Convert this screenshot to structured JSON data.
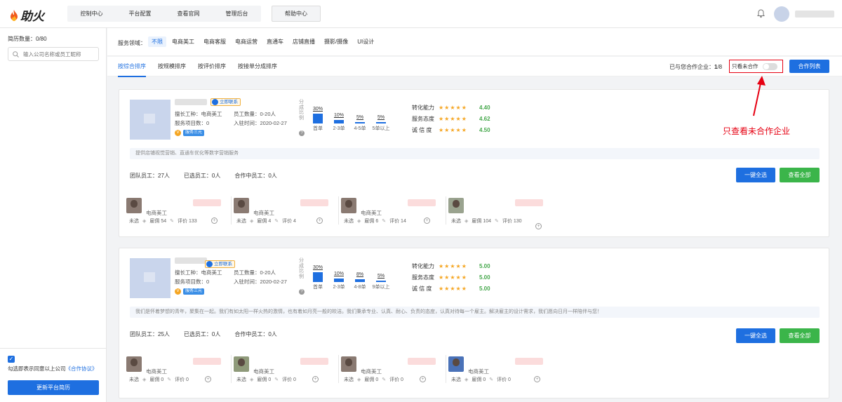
{
  "brand": {
    "name": "助火",
    "accent": "#1e6fe0",
    "logo_icon": "flame-icon"
  },
  "topnav": {
    "items": [
      "控制中心",
      "平台配置",
      "查看官网",
      "管理后台"
    ],
    "help": "帮助中心"
  },
  "sidebar": {
    "resume_count": "简历数量：0/80",
    "search_placeholder": "输入公司名称或员工昵称",
    "agree_text": "勾选即表示同意以上公司",
    "agree_link": "《合作协议》",
    "update_button": "更新平台简历"
  },
  "filter": {
    "label": "服务领域：",
    "options": [
      "不限",
      "电商美工",
      "电商客服",
      "电商运营",
      "直通车",
      "店铺直播",
      "摄影/摄像",
      "UI设计"
    ]
  },
  "sort": {
    "tabs": [
      "按综合排序",
      "按规模排序",
      "按评价排序",
      "按接单分成排序"
    ],
    "coop_prefix": "已与您合作企业：",
    "coop_value": "1",
    "coop_total": "/8",
    "toggle_label": "只看未合作",
    "coop_list_button": "合作列表"
  },
  "annotation": "只查看未合作企业",
  "cards": [
    {
      "contact": "立即联系",
      "info_left": [
        "擅长工种：电商美工",
        "服务项目数：0"
      ],
      "info_right": [
        "员工数量：0-20人",
        "入驻时间：2020-02-27"
      ],
      "service_tag": "服务三元",
      "dist_label": "分成比例",
      "bars": [
        {
          "pct": "30%",
          "value": 30,
          "cat": "首单"
        },
        {
          "pct": "10%",
          "value": 10,
          "cat": "2-3单"
        },
        {
          "pct": "5%",
          "value": 5,
          "cat": "4-5单"
        },
        {
          "pct": "5%",
          "value": 5,
          "cat": "5单以上"
        }
      ],
      "ratings": [
        {
          "label": "转化能力",
          "stars": "★★★★★",
          "value": "4.40"
        },
        {
          "label": "服务态度",
          "stars": "★★★★★",
          "value": "4.62"
        },
        {
          "label": "诚 信 度",
          "stars": "★★★★★",
          "value": "4.50"
        }
      ],
      "desc": "提供店铺视觉营销、直通车优化等数字营销服务",
      "team": [
        "团队员工：27人",
        "已选员工：0人",
        "合作中员工：0人"
      ],
      "btn_select": "一键全选",
      "btn_view": "查看全部",
      "members": [
        {
          "role": "电商美工",
          "status": "未选",
          "hire": "雇佣 54",
          "review": "评价 133"
        },
        {
          "role": "电商美工",
          "status": "未选",
          "hire": "雇佣 4",
          "review": "评价 4"
        },
        {
          "role": "电商美工",
          "status": "未选",
          "hire": "雇佣 6",
          "review": "评价 14"
        },
        {
          "role": "",
          "status": "未选",
          "hire": "雇佣 104",
          "review": "评价 130"
        }
      ]
    },
    {
      "contact": "立即联系",
      "info_left": [
        "擅长工种：电商美工",
        "服务项目数：0"
      ],
      "info_right": [
        "员工数量：0-20人",
        "入驻时间：2020-02-27"
      ],
      "service_tag": "服务三元",
      "dist_label": "分成比例",
      "bars": [
        {
          "pct": "30%",
          "value": 30,
          "cat": "首单"
        },
        {
          "pct": "10%",
          "value": 10,
          "cat": "2-3单"
        },
        {
          "pct": "8%",
          "value": 8,
          "cat": "4-8单"
        },
        {
          "pct": "5%",
          "value": 5,
          "cat": "9单以上"
        }
      ],
      "ratings": [
        {
          "label": "转化能力",
          "stars": "★★★★★",
          "value": "5.00"
        },
        {
          "label": "服务态度",
          "stars": "★★★★★",
          "value": "5.00"
        },
        {
          "label": "诚 信 度",
          "stars": "★★★★★",
          "value": "5.00"
        }
      ],
      "desc": "我们是怀着梦想的青年，聚集在一起。我们有如太阳一样火热的激情，也有着如月亮一般的皎洁。我们秉承专业、认真、耐心、负责的态度，认真对待每一个雇主。解决雇主的设计需求，我们愿向日月一样陪伴与您！",
      "team": [
        "团队员工：25人",
        "已选员工：0人",
        "合作中员工：0人"
      ],
      "btn_select": "一键全选",
      "btn_view": "查看全部",
      "members": [
        {
          "role": "电商美工",
          "status": "未选",
          "hire": "雇佣 0",
          "review": "评价 0"
        },
        {
          "role": "电商美工",
          "status": "未选",
          "hire": "雇佣 0",
          "review": "评价 0"
        },
        {
          "role": "电商美工",
          "status": "未选",
          "hire": "雇佣 0",
          "review": "评价 0"
        },
        {
          "role": "电商美工",
          "status": "未选",
          "hire": "雇佣 0",
          "review": "评价 0"
        }
      ]
    }
  ]
}
